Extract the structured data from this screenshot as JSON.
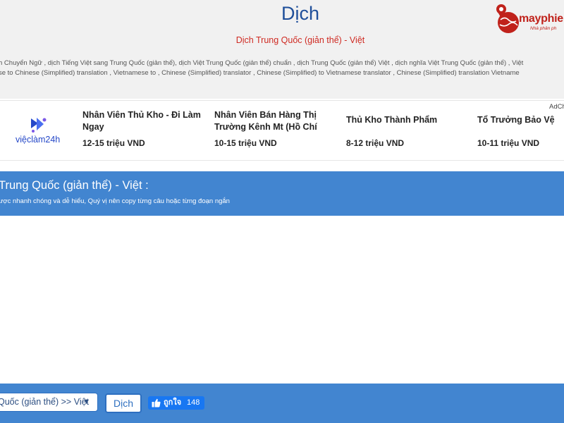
{
  "header": {
    "title": "Dịch",
    "subtitle": "Dịch Trung Quốc (giản thể) - Việt",
    "logo": {
      "name": "mayphie",
      "slogan": "Nhà phân ph"
    },
    "keywords_line1": "h Chuyển Ngữ , dịch Tiếng Việt sang Trung Quốc (giản thể), dịch Việt Trung Quốc (giản thể) chuẩn , dịch Trung Quốc (giản thể) Việt , dịch nghĩa Việt Trung Quốc (giản thể) , Việt",
    "keywords_line2": "se to Chinese (Simplified) translation , Vietnamese to , Chinese (Simplified) translator , Chinese (Simplified) to Vietnamese translator , Chinese (Simplified) translation Vietname"
  },
  "ad": {
    "label": "AdCh",
    "brand": "việclàm24h",
    "jobs": [
      {
        "title": "Nhân Viên Thủ Kho - Đi Làm Ngay",
        "salary": "12-15 triệu VND"
      },
      {
        "title": "Nhân Viên Bán Hàng Thị Trường Kênh Mt (Hồ Chí Min…",
        "salary": "10-15 triệu VND"
      },
      {
        "title": "Thủ Kho Thành Phẩm",
        "salary": "8-12 triệu VND"
      },
      {
        "title": "Tổ Trưởng Bảo Vệ",
        "salary": "10-11 triệu VND"
      }
    ]
  },
  "band": {
    "title": "Trung Quốc (giản thể) - Việt :",
    "note": "ược nhanh chóng và dễ hiểu, Quý vị nên copy từng câu hoặc từng đoạn ngắn"
  },
  "footer": {
    "language_select": "Quốc (giản thể) >> Việt",
    "translate_label": "Dịch",
    "like_label": "ถูกใจ",
    "like_count": "148"
  },
  "icons": {
    "logo": "globe-pin-icon",
    "ad_brand": "viec-lam-star-icon",
    "select_caret": "chevron-down-icon",
    "like": "thumbs-up-icon"
  },
  "colors": {
    "title_blue": "#1f4f9a",
    "subtitle_red": "#cf2a22",
    "band_blue": "#4285d0",
    "facebook_blue": "#1877f2",
    "brand_red": "#c0221b"
  }
}
